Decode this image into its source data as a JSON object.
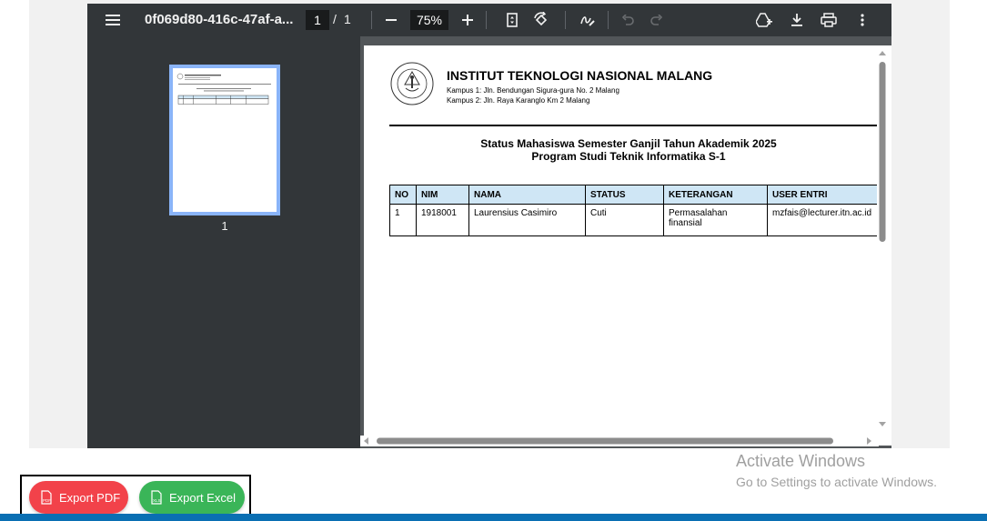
{
  "viewer": {
    "filename": "0f069d80-416c-47af-a...",
    "current_page": "1",
    "page_separator": "/",
    "total_pages": "1",
    "zoom": "75%",
    "thumbnail_label": "1",
    "background_color": "#525659",
    "toolbar_color": "#323639"
  },
  "toolbar_icons": [
    "menu-icon",
    "zoom-out-icon",
    "zoom-in-icon",
    "fit-page-icon",
    "rotate-icon",
    "annotate-icon",
    "undo-icon",
    "redo-icon",
    "add-to-drive-icon",
    "download-icon",
    "print-icon",
    "more-options-icon"
  ],
  "document": {
    "institution": "INSTITUT TEKNOLOGI NASIONAL MALANG",
    "campus1": "Kampus 1: Jln. Bendungan Sigura-gura No. 2 Malang",
    "campus2": "Kampus 2: Jln. Raya Karanglo Km 2 Malang",
    "report_title": "Status Mahasiswa Semester Ganjil Tahun Akademik 2025",
    "report_subtitle": "Program Studi Teknik Informatika S-1",
    "table": {
      "headers": [
        "NO",
        "NIM",
        "NAMA",
        "STATUS",
        "KETERANGAN",
        "USER ENTRI"
      ],
      "rows": [
        [
          "1",
          "1918001",
          "Laurensius Casimiro",
          "Cuti",
          "Permasalahan finansial",
          "mzfais@lecturer.itn.ac.id"
        ]
      ]
    },
    "header_fill_color": "#cfe6f5"
  },
  "watermark": {
    "line1": "Activate Windows",
    "line2": "Go to Settings to activate Windows."
  },
  "export": {
    "pdf_label": "Export PDF",
    "excel_label": "Export Excel",
    "pdf_color": "#f2424a",
    "excel_color": "#3ab558"
  }
}
